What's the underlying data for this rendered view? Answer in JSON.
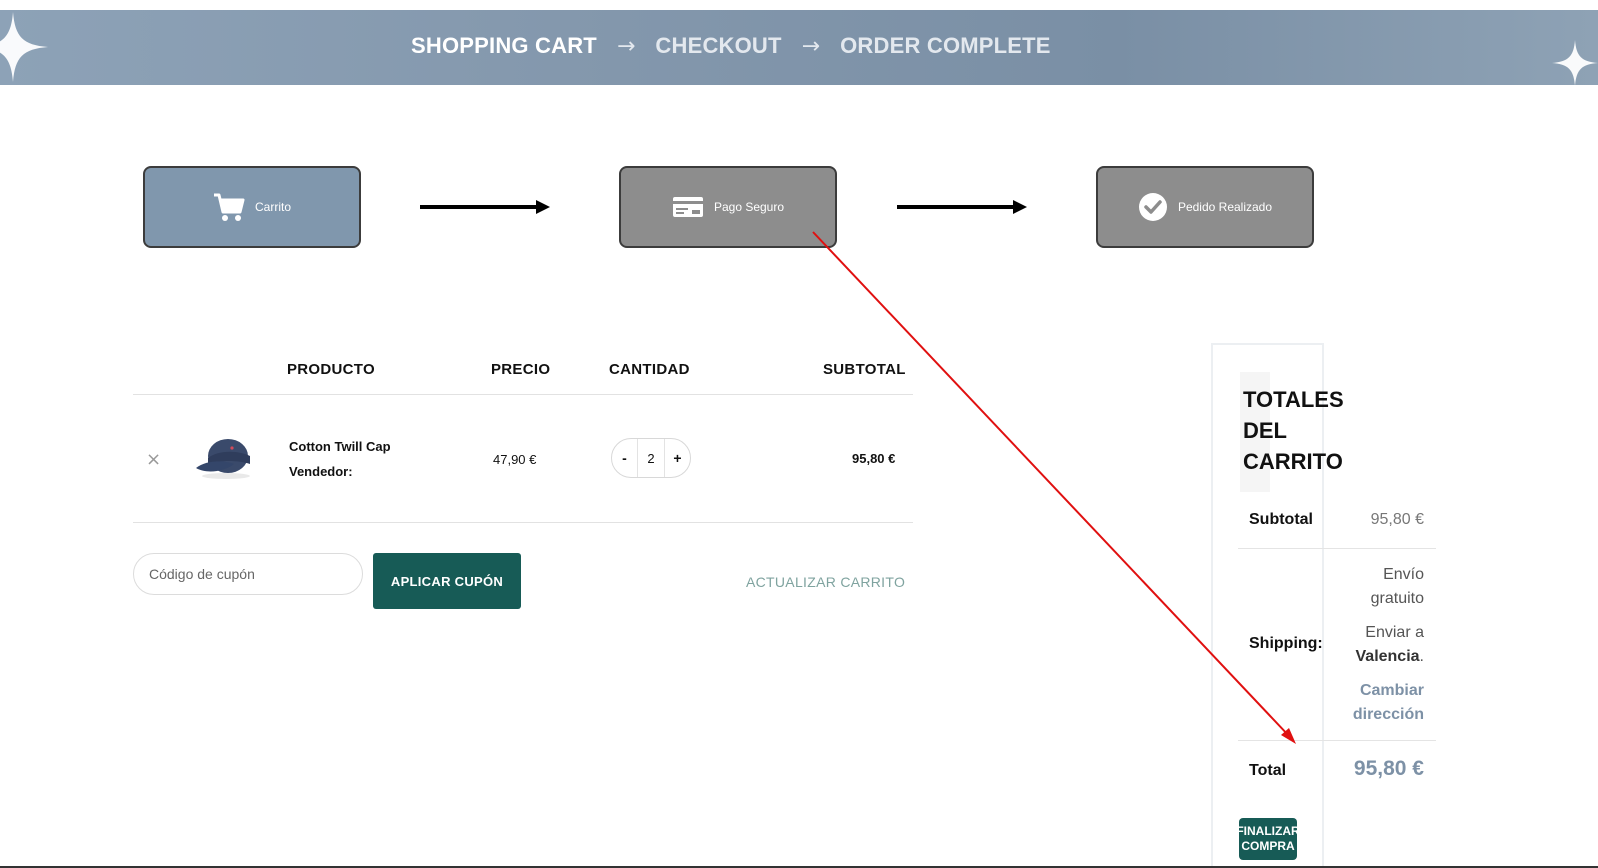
{
  "banner": {
    "steps": [
      "SHOPPING CART",
      "CHECKOUT",
      "ORDER COMPLETE"
    ],
    "arrow": "→"
  },
  "progress": {
    "cart": "Carrito",
    "payment": "Pago Seguro",
    "complete": "Pedido Realizado"
  },
  "table": {
    "headers": {
      "product": "PRODUCTO",
      "price": "PRECIO",
      "quantity": "CANTIDAD",
      "subtotal": "SUBTOTAL"
    },
    "row": {
      "remove": "×",
      "name": "Cotton Twill Cap",
      "vendor": "Vendedor:",
      "price": "47,90 €",
      "qty_minus": "-",
      "qty": "2",
      "qty_plus": "+",
      "subtotal": "95,80 €"
    }
  },
  "coupon": {
    "placeholder": "Código de cupón",
    "apply_label": "APLICAR CUPÓN",
    "update_label": "ACTUALIZAR CARRITO"
  },
  "totals": {
    "title_lines": [
      "TOTALES",
      "DEL",
      "CARRITO"
    ],
    "subtotal_label": "Subtotal",
    "subtotal_value": "95,80 €",
    "shipping_label": "Shipping:",
    "shipping_line1": "Envío",
    "shipping_line2": "gratuito",
    "shipping_line3": "Enviar a",
    "shipping_city": "Valencia",
    "shipping_period": ".",
    "change_line1": "Cambiar",
    "change_line2": "dirección",
    "total_label": "Total",
    "total_value": "95,80 €",
    "finalize_line1": "FINALIZAR",
    "finalize_line2": "COMPRA"
  },
  "colors": {
    "brand_green": "#175b56",
    "accent_blue": "#7d91a6",
    "annotation_red": "#e01010"
  }
}
